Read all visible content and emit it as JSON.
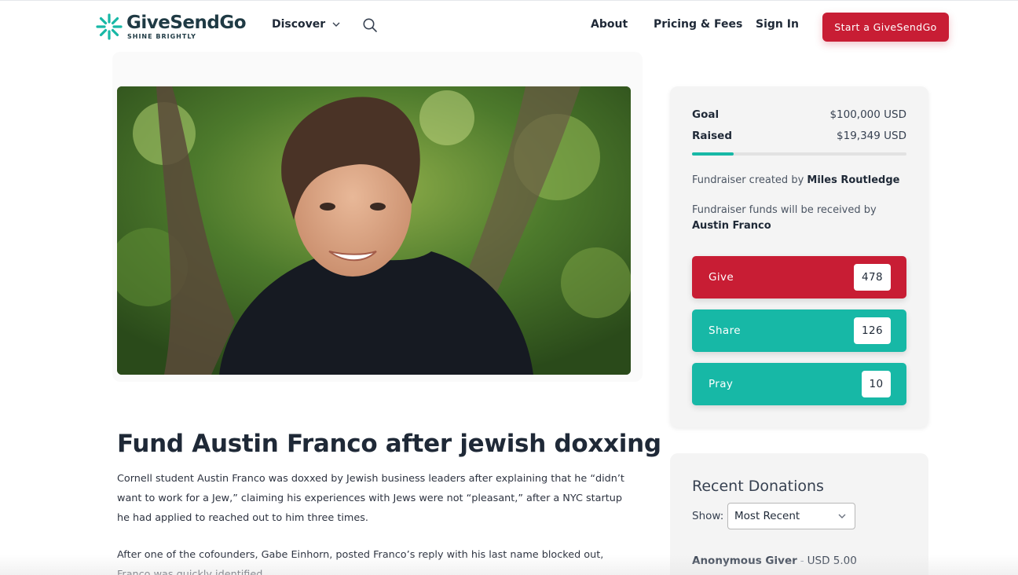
{
  "header": {
    "logo_name": "GiveSendGo",
    "logo_tagline": "SHINE BRIGHTLY",
    "discover_label": "Discover",
    "about_label": "About",
    "pricing_label": "Pricing & Fees",
    "signin_label": "Sign In",
    "start_label": "Start a GiveSendGo"
  },
  "campaign": {
    "title": "Fund Austin Franco after jewish doxxing",
    "paragraphs": [
      "Cornell student Austin Franco was doxxed by Jewish business leaders after explaining that he “didn’t want to work for a Jew,” claiming his experiences with Jews were not “pleasant,” after a NYC startup he had applied to reached out to him three times.",
      "After one of the cofounders, Gabe Einhorn, posted Franco’s reply with his last name blocked out, Franco was quickly identified."
    ]
  },
  "sidebar": {
    "goal_label": "Goal",
    "goal_value": "$100,000 USD",
    "raised_label": "Raised",
    "raised_value": "$19,349 USD",
    "progress_fraction": 0.19349,
    "created_prefix": "Fundraiser created by",
    "created_by": "Miles Routledge",
    "received_prefix": "Fundraiser funds will be received by",
    "received_by": "Austin Franco",
    "actions": [
      {
        "label": "Give",
        "count": "478",
        "color": "#c81d34"
      },
      {
        "label": "Share",
        "count": "126",
        "color": "#17b8a6"
      },
      {
        "label": "Pray",
        "count": "10",
        "color": "#17b8a6"
      }
    ]
  },
  "donations": {
    "title": "Recent Donations",
    "show_label": "Show:",
    "filter_value": "Most Recent",
    "items": [
      {
        "name": "Anonymous Giver",
        "separator": "-",
        "amount": "USD 5.00"
      }
    ]
  },
  "colors": {
    "brand_red": "#c81d34",
    "brand_teal": "#17b8a6"
  },
  "icons": {
    "logo": "givesendgo-logo-icon",
    "discover_chevron": "chevron-down-icon",
    "search": "search-icon",
    "select_chevron": "chevron-down-icon"
  }
}
